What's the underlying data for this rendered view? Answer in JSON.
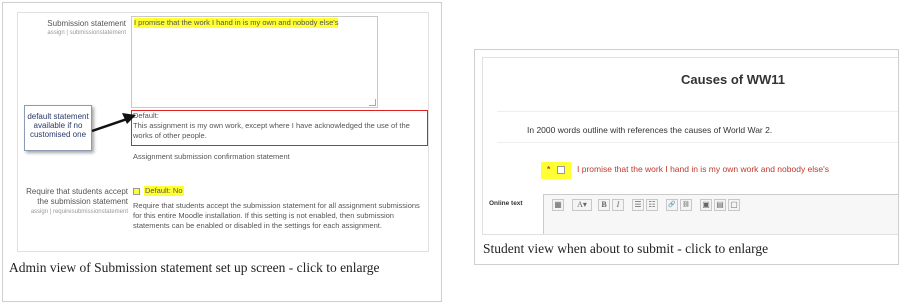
{
  "left": {
    "submission_statement_label": "Submission statement",
    "submission_statement_path": "assign | submissionstatement",
    "statement_text": "I promise that the work I hand in is my own and nobody else's",
    "default_heading": "Default:",
    "default_text": "This assignment is my own work, except where I have acknowledged the use of the works of other people.",
    "confirmation_label": "Assignment submission confirmation statement",
    "callout_text": "default statement available if no customised one",
    "require_label": "Require that students accept the submission statement",
    "require_path": "assign | requiresubmissionstatement",
    "require_default": "Default: No",
    "require_description": "Require that students accept the submission statement for all assignment submissions for this entire Moodle installation. If this setting is not enabled, then submission statements can be enabled or disabled in the settings for each assignment.",
    "caption": "Admin view of Submission statement set up screen - click to enlarge"
  },
  "right": {
    "title": "Causes of WW11",
    "instructions": "In 2000 words outline with references the causes of World War 2.",
    "required_marker": "*",
    "statement": "I promise that the work I hand in is my own work and nobody else's",
    "online_text_label": "Online text",
    "toolbar": [
      "▦",
      "A▾",
      "B",
      "I",
      "☰",
      "☷",
      "🔗",
      "⛓",
      "▣",
      "▤",
      "▢"
    ],
    "caption": "Student view when about to submit - click to enlarge"
  }
}
